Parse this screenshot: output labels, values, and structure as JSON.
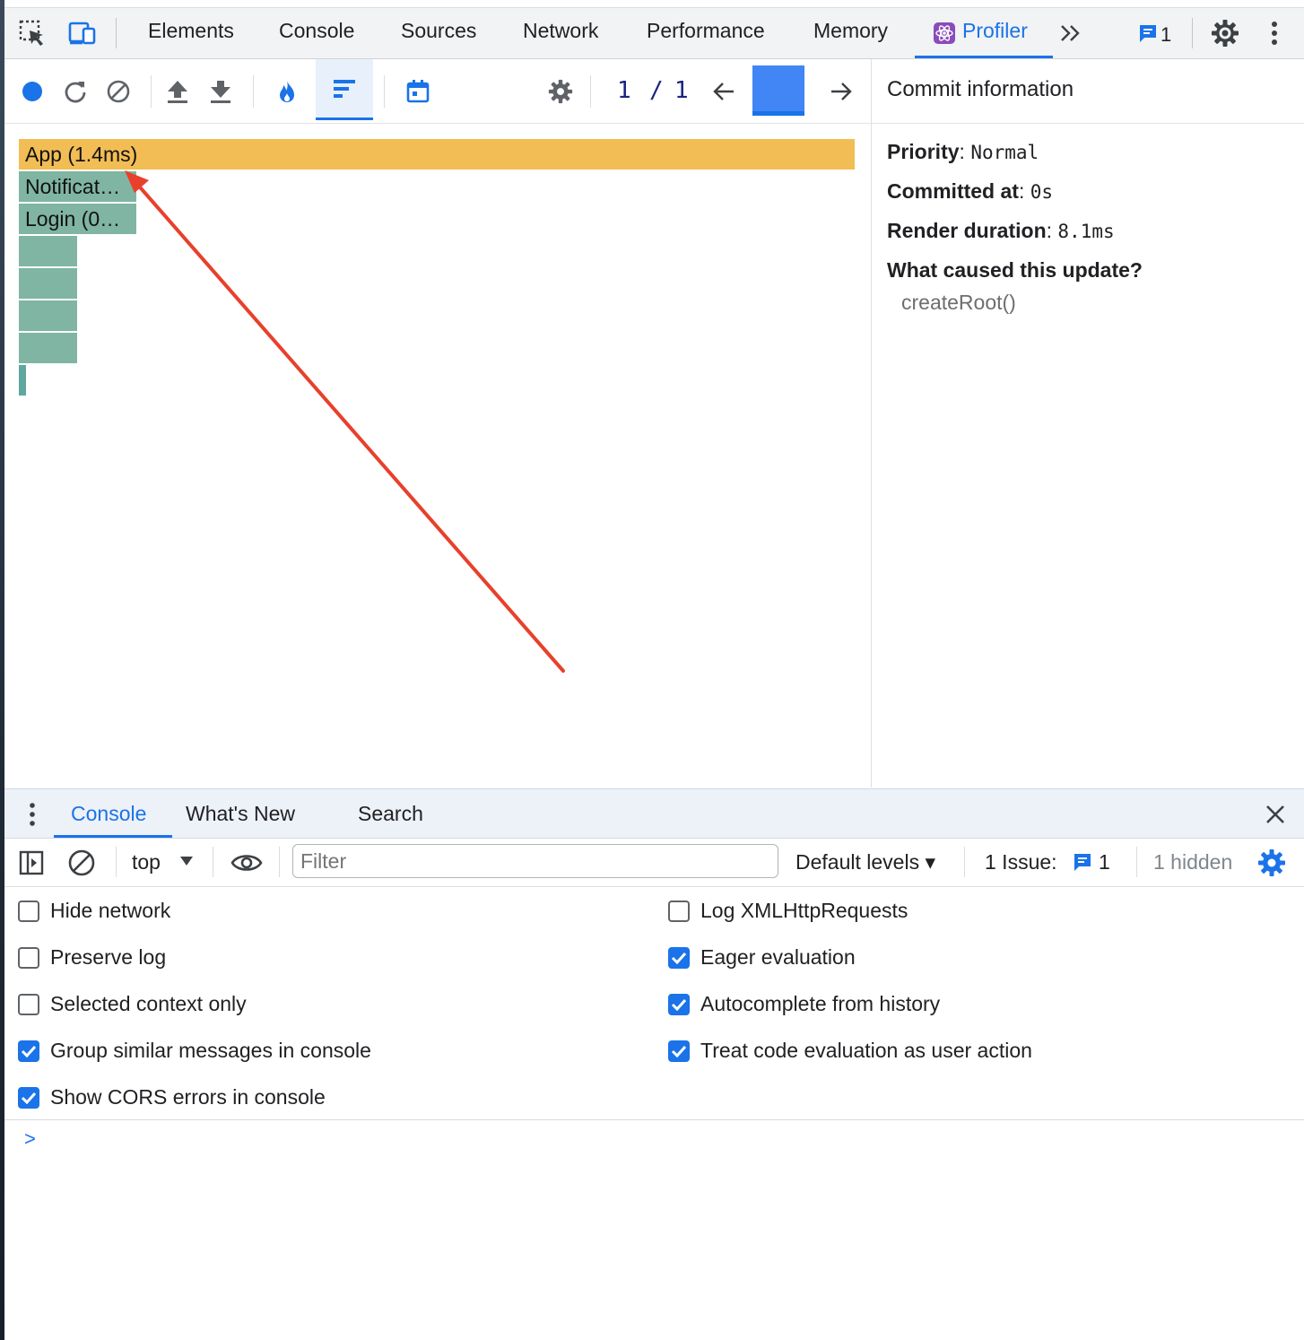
{
  "top_tabs": {
    "elements": "Elements",
    "console": "Console",
    "sources": "Sources",
    "network": "Network",
    "performance": "Performance",
    "memory": "Memory",
    "profiler": "Profiler",
    "more": "»",
    "issues_count": "1"
  },
  "profiler": {
    "commit_index": "1",
    "commit_separator": "/",
    "commit_total": "1",
    "flame_bars": {
      "app": "App (1.4ms)",
      "notifications": "Notificat…",
      "login": "Login (0…"
    }
  },
  "commit_info": {
    "title": "Commit information",
    "priority_label": "Priority",
    "priority_value": "Normal",
    "committed_label": "Committed at",
    "committed_value": "0s",
    "render_label": "Render duration",
    "render_value": "8.1ms",
    "cause_label": "What caused this update?",
    "cause_value": "createRoot()"
  },
  "drawer": {
    "tabs": {
      "console": "Console",
      "whats_new": "What's New",
      "search": "Search"
    },
    "toolbar": {
      "context": "top",
      "filter_placeholder": "Filter",
      "levels": "Default levels ▾",
      "issues_label": "1 Issue:",
      "issues_count": "1",
      "hidden": "1 hidden"
    },
    "options": {
      "hide_network": "Hide network",
      "preserve_log": "Preserve log",
      "selected_context": "Selected context only",
      "group_similar": "Group similar messages in console",
      "show_cors": "Show CORS errors in console",
      "log_xhr": "Log XMLHttpRequests",
      "eager_eval": "Eager evaluation",
      "autocomplete": "Autocomplete from history",
      "treat_code": "Treat code evaluation as user action"
    },
    "prompt": ">"
  },
  "colors": {
    "accent": "#1a73e8",
    "app_bar": "#f2bd54",
    "child_bar": "#7fb5a2",
    "annotation_arrow": "#e8402c"
  }
}
